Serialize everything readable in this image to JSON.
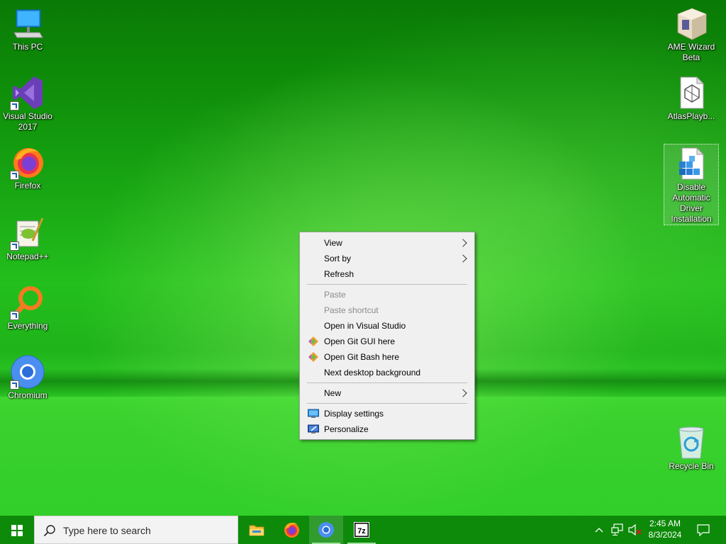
{
  "desktop": {
    "icons_left": [
      {
        "label": "This PC",
        "icon": "computer-icon"
      },
      {
        "label": "Visual Studio 2017",
        "icon": "visual-studio-icon"
      },
      {
        "label": "Firefox",
        "icon": "firefox-icon"
      },
      {
        "label": "Notepad++",
        "icon": "notepad-plus-plus-icon"
      },
      {
        "label": "Everything",
        "icon": "everything-search-icon"
      },
      {
        "label": "Chromium",
        "icon": "chromium-icon"
      }
    ],
    "icons_right": [
      {
        "label": "AME Wizard Beta",
        "icon": "ame-wizard-icon"
      },
      {
        "label": "AtlasPlayb...",
        "icon": "atlas-playbook-icon"
      },
      {
        "label": "Disable Automatic Driver Installation",
        "icon": "registry-file-icon",
        "selected": true
      },
      {
        "label": "Recycle Bin",
        "icon": "recycle-bin-icon"
      }
    ]
  },
  "context_menu": {
    "items": [
      {
        "label": "View",
        "submenu": true
      },
      {
        "label": "Sort by",
        "submenu": true
      },
      {
        "label": "Refresh"
      },
      {
        "label": "Paste",
        "disabled": true
      },
      {
        "label": "Paste shortcut",
        "disabled": true
      },
      {
        "label": "Open in Visual Studio"
      },
      {
        "label": "Open Git GUI here",
        "icon": "git-icon"
      },
      {
        "label": "Open Git Bash here",
        "icon": "git-icon"
      },
      {
        "label": "Next desktop background"
      },
      {
        "label": "New",
        "submenu": true
      },
      {
        "label": "Display settings",
        "icon": "display-icon"
      },
      {
        "label": "Personalize",
        "icon": "personalize-icon"
      }
    ]
  },
  "taskbar": {
    "search_placeholder": "Type here to search",
    "pinned": [
      "file-explorer-icon",
      "firefox-icon",
      "chromium-icon",
      "7zip-icon"
    ],
    "active": "chromium-icon",
    "tray_icons": [
      "chevron-up-icon",
      "network-icon",
      "volume-muted-icon"
    ],
    "time": "2:45 AM",
    "date": "8/3/2024",
    "notification_icon": "notification-icon"
  },
  "colors": {
    "wallpaper": "#1fb41a",
    "taskbar": "#0d8a09",
    "menu_bg": "#f0f0f0"
  }
}
